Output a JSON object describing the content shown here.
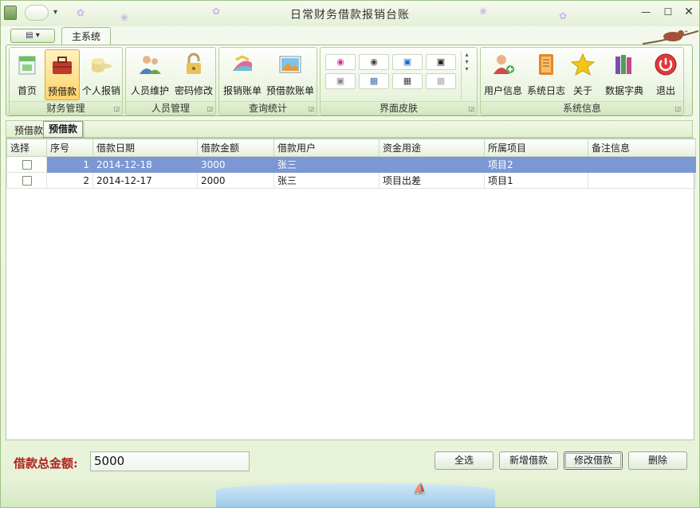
{
  "window": {
    "title": "日常财务借款报销台账"
  },
  "ribbon": {
    "tab": "主系统",
    "groups": [
      {
        "label": "财务管理",
        "buttons": [
          "首页",
          "预借款",
          "个人报销"
        ]
      },
      {
        "label": "人员管理",
        "buttons": [
          "人员维护",
          "密码修改"
        ]
      },
      {
        "label": "查询统计",
        "buttons": [
          "报销账单",
          "预借款账单"
        ]
      },
      {
        "label": "界面皮肤",
        "buttons": []
      },
      {
        "label": "系统信息",
        "buttons": [
          "用户信息",
          "系统日志",
          "关于",
          "数据字典",
          "退出"
        ]
      }
    ],
    "active_button": "预借款"
  },
  "doc_tab": {
    "label": "预借款",
    "tooltip": "预借款"
  },
  "table": {
    "columns": [
      "选择",
      "序号",
      "借款日期",
      "借款金额",
      "借款用户",
      "资金用途",
      "所属项目",
      "备注信息"
    ],
    "rows": [
      {
        "checked": false,
        "selected": true,
        "cells": [
          "1",
          "2014-12-18",
          "3000",
          "张三",
          "",
          "项目2",
          ""
        ]
      },
      {
        "checked": false,
        "selected": false,
        "cells": [
          "2",
          "2014-12-17",
          "2000",
          "张三",
          "项目出差",
          "项目1",
          ""
        ]
      }
    ]
  },
  "footer": {
    "total_label": "借款总金额:",
    "total_value": "5000",
    "buttons": [
      "全选",
      "新增借款",
      "修改借款",
      "删除"
    ]
  },
  "colors": {
    "selection": "#7b98d4",
    "total_label": "#b02020",
    "ribbon_bg": "#e9f3dd"
  }
}
